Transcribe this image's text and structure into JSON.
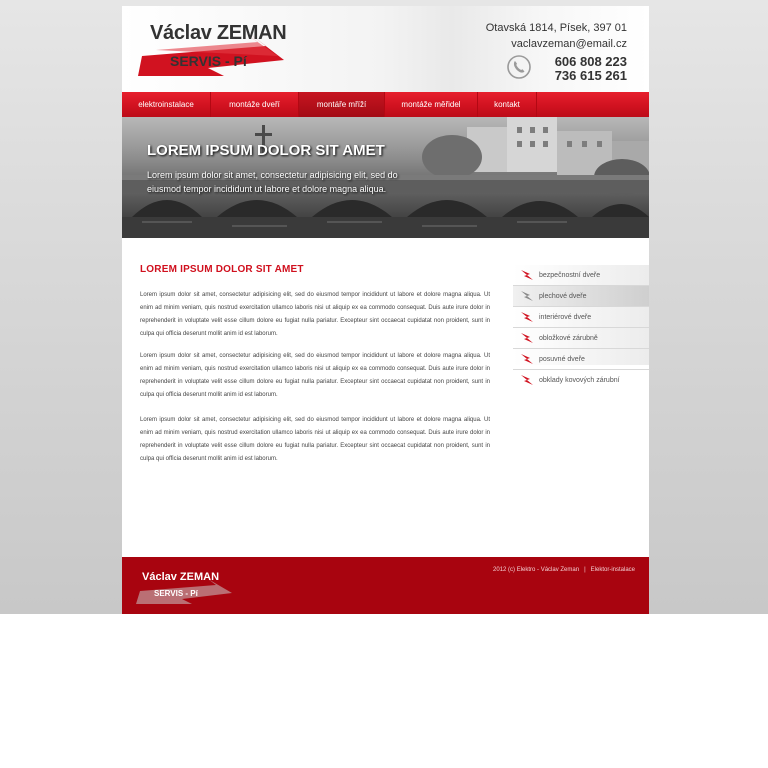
{
  "header": {
    "logo_name": "Václav ZEMAN",
    "logo_sub": "SERVIS - Pí",
    "address": "Otavská 1814, Písek, 397 01",
    "email": "vaclavzeman@email.cz",
    "phones": [
      "606 808 223",
      "736 615 261"
    ]
  },
  "nav": {
    "items": [
      {
        "label": "elektroinstalace"
      },
      {
        "label": "montáže dveří"
      },
      {
        "label": "montáře mříží"
      },
      {
        "label": "montáže měřidel"
      },
      {
        "label": "kontakt"
      }
    ],
    "active_index": 2
  },
  "banner": {
    "title": "LOREM IPSUM DOLOR SIT AMET",
    "text": "Lorem ipsum dolor sit amet, consectetur adipisicing elit, sed do eiusmod tempor incididunt ut labore et dolore magna aliqua."
  },
  "content": {
    "title": "LOREM IPSUM DOLOR SIT AMET",
    "paragraphs": [
      "Lorem ipsum dolor sit amet, consectetur adipisicing elit, sed do eiusmod tempor incididunt ut labore et dolore magna aliqua. Ut enim ad minim veniam, quis nostrud exercitation ullamco laboris nisi ut aliquip ex ea commodo consequat. Duis aute irure dolor in reprehenderit in voluptate velit esse cillum dolore eu fugiat nulla pariatur. Excepteur sint occaecat cupidatat non proident, sunt in culpa qui officia deserunt mollit anim id est laborum.",
      "Lorem ipsum dolor sit amet, consectetur adipisicing elit, sed do eiusmod tempor incididunt ut labore et dolore magna aliqua. Ut enim ad minim veniam, quis nostrud exercitation ullamco laboris nisi ut aliquip ex ea commodo consequat. Duis aute irure dolor in reprehenderit in voluptate velit esse cillum dolore eu fugiat nulla pariatur. Excepteur sint occaecat cupidatat non proident, sunt in culpa qui officia deserunt mollit anim id est laborum.",
      "Lorem ipsum dolor sit amet, consectetur adipisicing elit, sed do eiusmod tempor incididunt ut labore et dolore magna aliqua. Ut enim ad minim veniam, quis nostrud exercitation ullamco laboris nisi ut aliquip ex ea commodo consequat. Duis aute irure dolor in reprehenderit in voluptate velit esse cillum dolore eu fugiat nulla pariatur. Excepteur sint occaecat cupidatat non proident, sunt in culpa qui officia deserunt mollit anim id est laborum."
    ]
  },
  "sidebar": {
    "items": [
      {
        "label": "bezpečnostní dveře"
      },
      {
        "label": "plechové dveře"
      },
      {
        "label": "interiérové dveře"
      },
      {
        "label": "obložkové zárubně"
      },
      {
        "label": "posuvné dveře"
      },
      {
        "label": "obklady kovových zárubní"
      }
    ],
    "active_index": 1
  },
  "footer": {
    "logo_name": "Václav ZEMAN",
    "logo_sub": "SERVIS - Pí",
    "copyright": "2012 (c) Elektro - Václav Zeman",
    "separator": "|",
    "link": "Elektor-instalace"
  },
  "colors": {
    "accent": "#d11220",
    "footer": "#a8040f",
    "title": "#d0101e"
  },
  "icons": {
    "phone": "phone-icon",
    "sidebar_bullet": "lightning-bolt-icon",
    "logo_bolt": "lightning-bolt-icon"
  }
}
